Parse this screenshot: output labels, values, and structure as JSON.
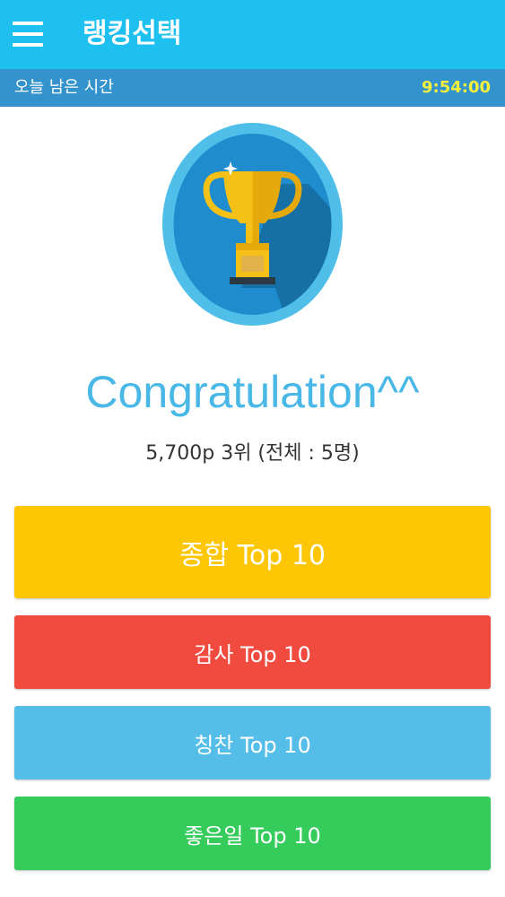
{
  "app_bar": {
    "title": "랭킹선택",
    "menu_icon": "hamburger-menu-icon"
  },
  "time_bar": {
    "label": "오늘 남은 시간",
    "value": "9:54:00"
  },
  "trophy": {
    "icon": "trophy-icon"
  },
  "result": {
    "headline": "Congratulation^^",
    "summary": "5,700p 3위 (전체 : 5명)"
  },
  "buttons": [
    {
      "label": "종합 Top 10",
      "color": "#fec605"
    },
    {
      "label": "감사 Top 10",
      "color": "#f14b40"
    },
    {
      "label": "칭찬 Top 10",
      "color": "#54bde8"
    },
    {
      "label": "좋은일 Top 10",
      "color": "#35cc5c"
    }
  ],
  "colors": {
    "app_bar": "#1ec0f0",
    "time_bar": "#3493cd",
    "time_value": "#f5f03c",
    "headline": "#49b8e6"
  }
}
